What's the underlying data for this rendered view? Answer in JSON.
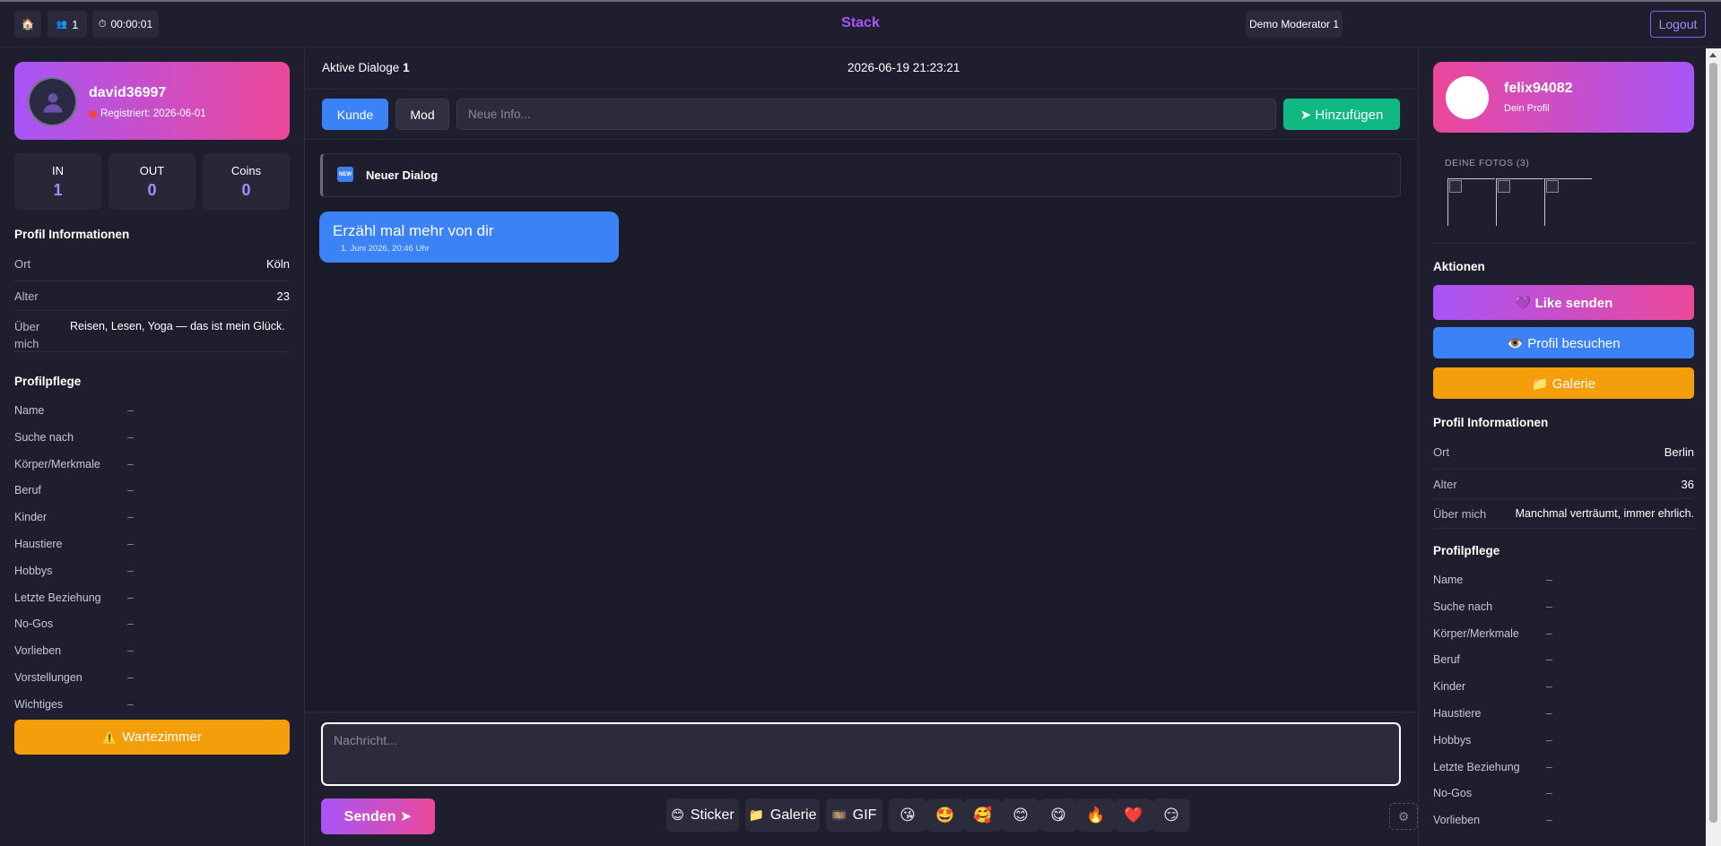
{
  "header": {
    "home_icon": "🏠",
    "users_icon": "👥",
    "users_count": "1",
    "timer_icon": "⏱",
    "timer": "00:00:01",
    "brand": "Stack",
    "moderator": "Demo Moderator 1",
    "logout": "Logout"
  },
  "left": {
    "username": "david36997",
    "registered": "Registriert: 2026-06-01",
    "stats": [
      {
        "label": "IN",
        "value": "1"
      },
      {
        "label": "OUT",
        "value": "0"
      },
      {
        "label": "Coins",
        "value": "0"
      }
    ],
    "info_title": "Profil Informationen",
    "info": [
      {
        "key": "Ort",
        "value": "Köln"
      },
      {
        "key": "Alter",
        "value": "23"
      },
      {
        "key": "Über mich",
        "value": "Reisen, Lesen, Yoga — das ist mein Glück."
      }
    ],
    "pflege_title": "Profilpflege",
    "pflege": [
      {
        "key": "Name",
        "value": "–"
      },
      {
        "key": "Suche nach",
        "value": "–"
      },
      {
        "key": "Körper/Merkmale",
        "value": "–"
      },
      {
        "key": "Beruf",
        "value": "–"
      },
      {
        "key": "Kinder",
        "value": "–"
      },
      {
        "key": "Haustiere",
        "value": "–"
      },
      {
        "key": "Hobbys",
        "value": "–"
      },
      {
        "key": "Letzte Beziehung",
        "value": "–"
      },
      {
        "key": "No-Gos",
        "value": "–"
      },
      {
        "key": "Vorlieben",
        "value": "–"
      },
      {
        "key": "Vorstellungen",
        "value": "–"
      },
      {
        "key": "Wichtiges",
        "value": "–"
      }
    ],
    "waiting_icon": "⚠️",
    "waiting_label": "Wartezimmer"
  },
  "middle": {
    "active_label": "Aktive Dialoge",
    "active_count": "1",
    "datetime": "2026-06-19 21:23:21",
    "kunde_label": "Kunde",
    "mod_label": "Mod",
    "info_placeholder": "Neue Info...",
    "add_label": "➤ Hinzufügen",
    "new_badge": "NEW",
    "new_dialog": "Neuer Dialog",
    "message": "Erzähl mal mehr von dir",
    "message_time": "1. Juni 2026, 20:46 Uhr",
    "composer_placeholder": "Nachricht...",
    "send_label": "Senden ➤",
    "tools": [
      {
        "icon": "😊",
        "label": "Sticker"
      },
      {
        "icon": "📁",
        "label": "Galerie"
      },
      {
        "icon": "🎞️",
        "label": "GIF"
      }
    ],
    "emojis": [
      "😘",
      "🤩",
      "🥰",
      "😊",
      "😋",
      "🔥",
      "❤️",
      "😏"
    ],
    "settings_icon": "⚙"
  },
  "right": {
    "username": "felix94082",
    "subtitle": "Dein Profil",
    "photos_title": "DEINE FOTOS (3)",
    "actions_title": "Aktionen",
    "like_label": "💜 Like senden",
    "visit_label": "👁️ Profil besuchen",
    "gallery_label": "📁 Galerie",
    "info_title": "Profil Informationen",
    "info": [
      {
        "key": "Ort",
        "value": "Berlin"
      },
      {
        "key": "Alter",
        "value": "36"
      },
      {
        "key": "Über mich",
        "value": "Manchmal verträumt, immer ehrlich."
      }
    ],
    "pflege_title": "Profilpflege",
    "pflege": [
      {
        "key": "Name",
        "value": "–"
      },
      {
        "key": "Suche nach",
        "value": "–"
      },
      {
        "key": "Körper/Merkmale",
        "value": "–"
      },
      {
        "key": "Beruf",
        "value": "–"
      },
      {
        "key": "Kinder",
        "value": "–"
      },
      {
        "key": "Haustiere",
        "value": "–"
      },
      {
        "key": "Hobbys",
        "value": "–"
      },
      {
        "key": "Letzte Beziehung",
        "value": "–"
      },
      {
        "key": "No-Gos",
        "value": "–"
      },
      {
        "key": "Vorlieben",
        "value": "–"
      }
    ]
  },
  "colors": {
    "background": "#1b1b2b",
    "accent_purple": "#a855f7",
    "accent_pink": "#ec4899",
    "blue": "#3b82f6",
    "green": "#10b981",
    "orange": "#f59e0b"
  }
}
